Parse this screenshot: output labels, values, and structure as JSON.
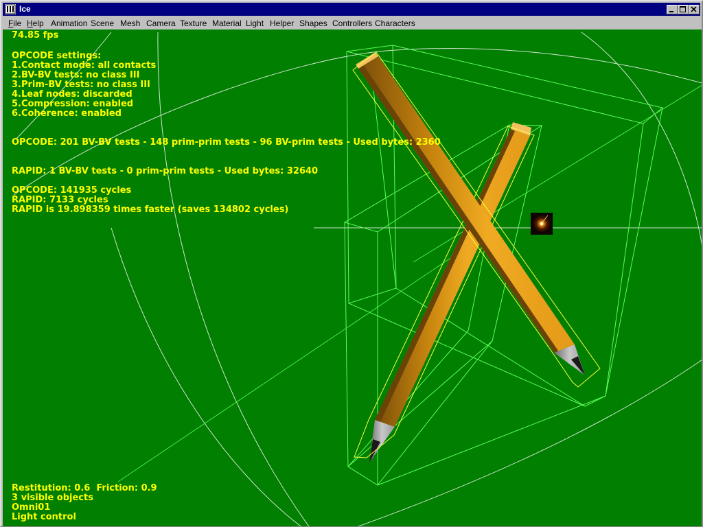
{
  "window": {
    "title": "Ice"
  },
  "menu": {
    "items": [
      {
        "label": "File",
        "mnemonic": "F"
      },
      {
        "label": "Help",
        "mnemonic": "H"
      },
      {
        "label": "Animation"
      },
      {
        "label": "Scene"
      },
      {
        "label": "Mesh"
      },
      {
        "label": "Camera"
      },
      {
        "label": "Texture"
      },
      {
        "label": "Material"
      },
      {
        "label": "Light"
      },
      {
        "label": "Helper"
      },
      {
        "label": "Shapes"
      },
      {
        "label": "Controllers"
      },
      {
        "label": "Characters"
      }
    ]
  },
  "hud": {
    "fps": "74.85 fps",
    "settings_title": "OPCODE settings:",
    "settings": [
      "1.Contact mode: all contacts",
      "2.BV-BV tests: no class III",
      "3.Prim-BV tests: no class III",
      "4.Leaf nodes: discarded",
      "5.Compression: enabled",
      "6.Coherence: enabled"
    ],
    "opcode_stats": "OPCODE: 201 BV-BV tests - 148 prim-prim tests - 96 BV-prim tests - Used bytes: 2360",
    "rapid_stats": "RAPID: 1 BV-BV tests - 0 prim-prim tests - Used bytes: 32640",
    "opcode_cycles": "OPCODE: 141935 cycles",
    "rapid_cycles": "RAPID: 7133 cycles",
    "comparison": "RAPID is 19.898359 times faster (saves 134802 cycles)",
    "footer": [
      "Restitution: 0.6  Friction: 0.9",
      "3 visible objects",
      "Omni01",
      "Light control"
    ]
  },
  "colors": {
    "viewport_bg": "#007f00",
    "hud_text": "#ffff00",
    "bbox_wire": "#5cff5c",
    "obb_wire": "#ffff40",
    "pencil_body": "#e8a21c",
    "titlebar": "#000080"
  }
}
